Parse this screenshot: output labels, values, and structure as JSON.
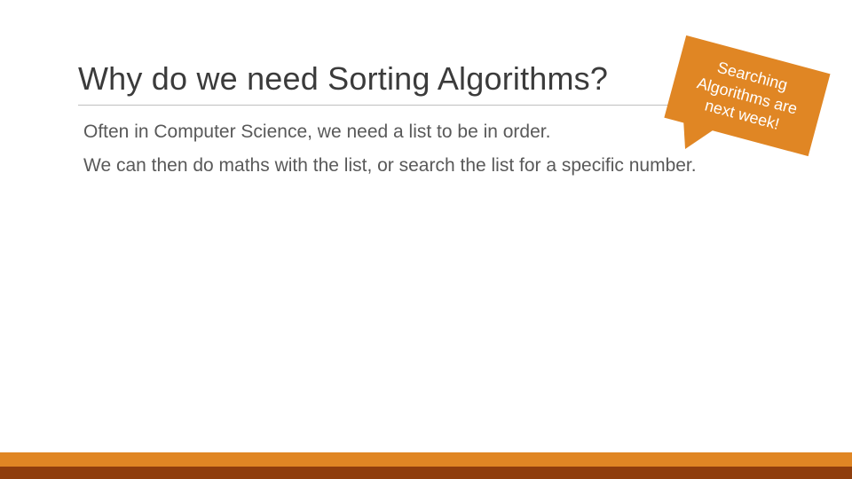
{
  "title": "Why do we need Sorting Algorithms?",
  "body": {
    "p1": "Often in Computer Science, we need a list to be in order.",
    "p2": "We can then do maths with the list, or search the list for a specific number."
  },
  "callout": {
    "text": "Searching Algorithms are next week!"
  },
  "colors": {
    "accentOrange": "#e08624",
    "accentBrown": "#8f3e0d"
  }
}
